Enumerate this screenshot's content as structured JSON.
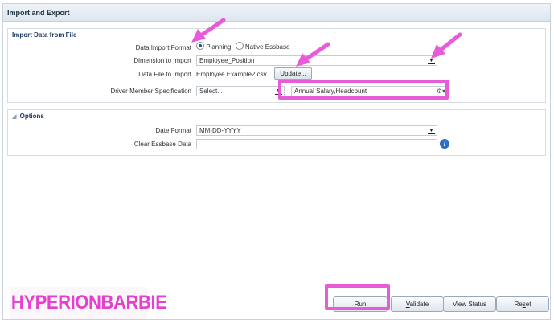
{
  "panel": {
    "title": "Import and Export"
  },
  "import_section": {
    "title": "Import Data from File",
    "format": {
      "label": "Data Import Format",
      "options": [
        "Planning",
        "Native Essbase"
      ],
      "selected": "Planning"
    },
    "dimension": {
      "label": "Dimension to Import",
      "value": "Employee_Position"
    },
    "file": {
      "label": "Data File to Import",
      "value": "Employee Example2.csv",
      "button": "Update..."
    },
    "driver": {
      "label": "Driver Member Specification",
      "select_value": "Select...",
      "members_value": "Annual Salary,Headcount"
    }
  },
  "options_section": {
    "title": "Options",
    "date_format": {
      "label": "Date Format",
      "value": "MM-DD-YYYY"
    },
    "clear_essbase": {
      "label": "Clear Essbase Data",
      "value": ""
    }
  },
  "footer": {
    "logo_text": "HYPERIONBARBIE",
    "buttons": {
      "run": {
        "prefix": "",
        "underline": "R",
        "rest": "un"
      },
      "validate": {
        "prefix": "",
        "underline": "V",
        "rest": "alidate"
      },
      "view_status": "View Status",
      "reset": {
        "prefix": "Re",
        "underline": "s",
        "rest": "et"
      }
    }
  },
  "colors": {
    "highlight": "#e85bd8",
    "header": "#dde6ef",
    "info": "#2a6fc4"
  },
  "icons": [
    "dropdown-arrow-icon",
    "member-selector-icon",
    "info-icon",
    "collapse-triangle-icon"
  ]
}
